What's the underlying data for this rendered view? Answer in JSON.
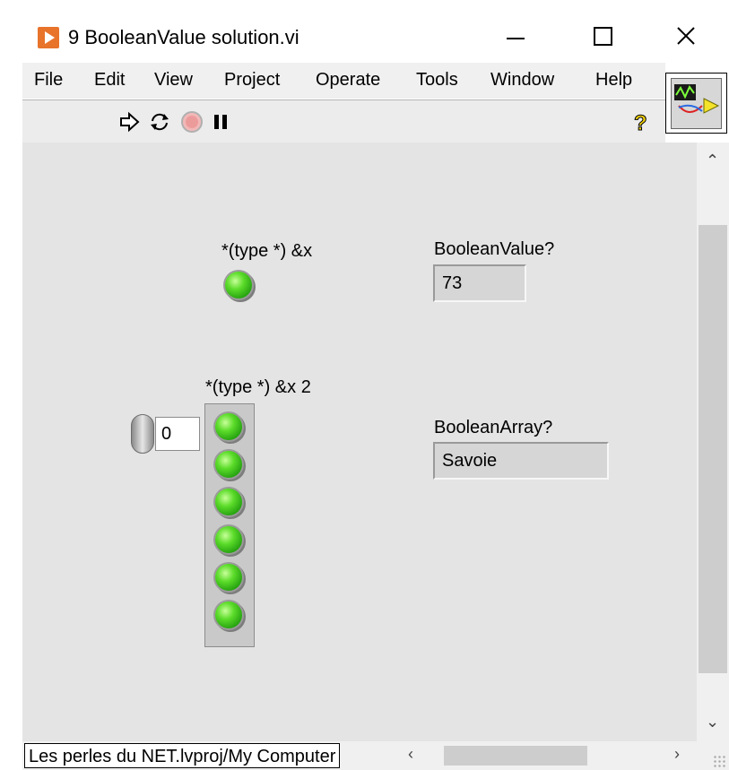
{
  "window": {
    "title": "9 BooleanValue solution.vi",
    "accent": "#e8732b"
  },
  "menu": [
    "File",
    "Edit",
    "View",
    "Project",
    "Operate",
    "Tools",
    "Window",
    "Help"
  ],
  "toolbar": {
    "icons": [
      "run-arrow-icon",
      "run-continuously-icon",
      "abort-icon",
      "pause-icon",
      "help-icon"
    ]
  },
  "panel": {
    "boolean_control": {
      "label": "*(type *) &x",
      "state": "on",
      "color": "#5cdc2a"
    },
    "boolean_value_indicator": {
      "label": "BooleanValue?",
      "value": "73"
    },
    "boolean_array": {
      "label": "*(type *) &x 2",
      "index": "0",
      "count": 6
    },
    "boolean_array_indicator": {
      "label": "BooleanArray?",
      "value": "Savoie"
    }
  },
  "statusbar": {
    "path": "Les perles du NET.lvproj/My Computer"
  }
}
